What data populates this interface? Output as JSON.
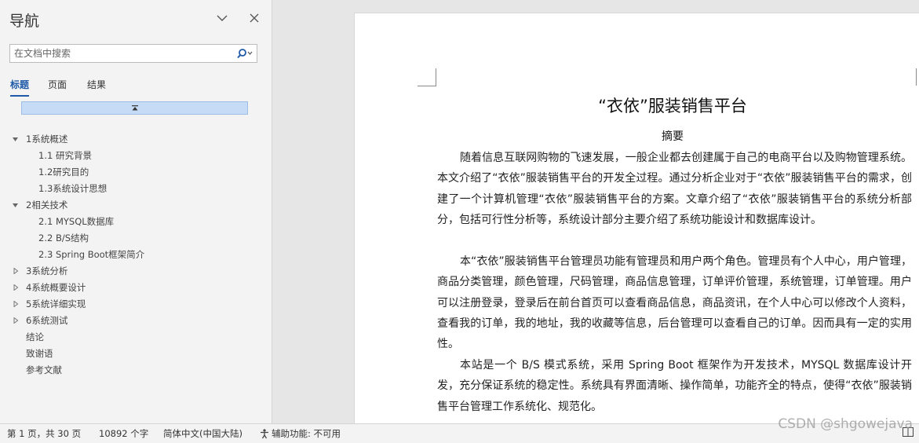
{
  "nav": {
    "title": "导航",
    "search_placeholder": "在文档中搜索",
    "tabs": [
      "标题",
      "页面",
      "结果"
    ],
    "active_tab": "标题",
    "outline": [
      {
        "label": "1系统概述",
        "level": 1,
        "expanded": true
      },
      {
        "label": "1.1 研究背景",
        "level": 2
      },
      {
        "label": "1.2研究目的",
        "level": 2
      },
      {
        "label": "1.3系统设计思想",
        "level": 2
      },
      {
        "label": "2相关技术",
        "level": 1,
        "expanded": true
      },
      {
        "label": "2.1 MYSQL数据库",
        "level": 2
      },
      {
        "label": "2.2 B/S结构",
        "level": 2
      },
      {
        "label": "2.3 Spring Boot框架简介",
        "level": 2
      },
      {
        "label": "3系统分析",
        "level": 1,
        "expanded": false
      },
      {
        "label": "4系统概要设计",
        "level": 1,
        "expanded": false
      },
      {
        "label": "5系统详细实现",
        "level": 1,
        "expanded": false
      },
      {
        "label": "6系统测试",
        "level": 1,
        "expanded": false
      },
      {
        "label": "结论",
        "level": 1
      },
      {
        "label": "致谢语",
        "level": 1
      },
      {
        "label": "参考文献",
        "level": 1
      }
    ]
  },
  "document": {
    "title": "“衣依”服装销售平台",
    "abstract_heading": "摘要",
    "paragraphs": [
      "随着信息互联网购物的飞速发展，一般企业都去创建属于自己的电商平台以及购物管理系统。本文介绍了“衣依”服装销售平台的开发全过程。通过分析企业对于“衣依”服装销售平台的需求，创建了一个计算机管理“衣依”服装销售平台的方案。文章介绍了“衣依”服装销售平台的系统分析部分，包括可行性分析等，系统设计部分主要介绍了系统功能设计和数据库设计。",
      "本“衣依”服装销售平台管理员功能有管理员和用户两个角色。管理员有个人中心，用户管理，商品分类管理，颜色管理，尺码管理，商品信息管理，订单评价管理，系统管理，订单管理。用户可以注册登录，登录后在前台首页可以查看商品信息，商品资讯，在个人中心可以修改个人资料，查看我的订单，我的地址，我的收藏等信息，后台管理可以查看自己的订单。因而具有一定的实用性。",
      "本站是一个 B/S 模式系统，采用 Spring Boot 框架作为开发技术，MYSQL 数据库设计开发，充分保证系统的稳定性。系统具有界面清晰、操作简单，功能齐全的特点，使得“衣依”服装销售平台管理工作系统化、规范化。"
    ]
  },
  "status": {
    "page_info": "第 1 页，共 30 页",
    "word_count": "10892 个字",
    "language": "简体中文(中国大陆)",
    "accessibility": "辅助功能: 不可用"
  },
  "watermark": "CSDN @shgowejava"
}
